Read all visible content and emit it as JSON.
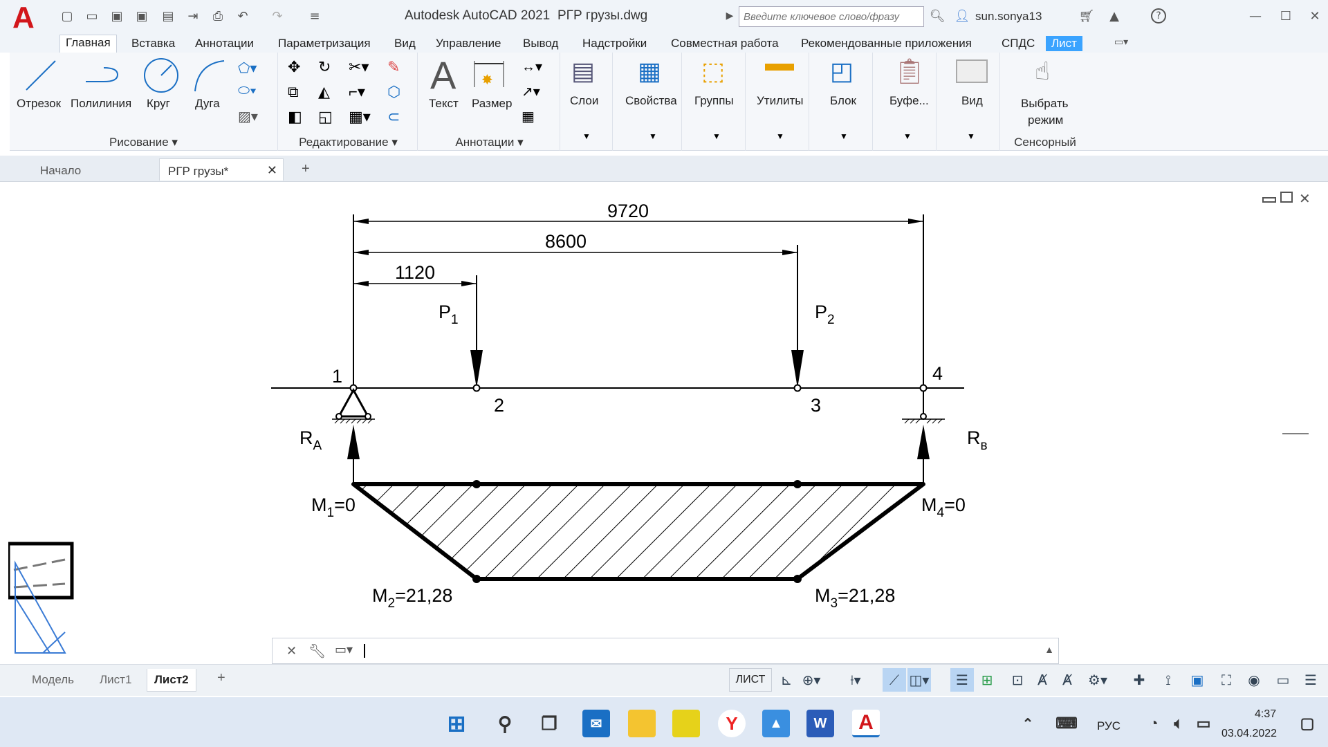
{
  "app": {
    "title": "Autodesk AutoCAD 2021",
    "file": "РГР грузы.dwg",
    "search_placeholder": "Введите ключевое слово/фразу",
    "user": "sun.sonya13"
  },
  "menu_tabs": [
    "Главная",
    "Вставка",
    "Аннотации",
    "Параметризация",
    "Вид",
    "Управление",
    "Вывод",
    "Надстройки",
    "Совместная работа",
    "Рекомендованные приложения",
    "СПДС",
    "Лист"
  ],
  "ribbon": {
    "draw": {
      "title": "Рисование",
      "tools": [
        "Отрезок",
        "Полилиния",
        "Круг",
        "Дуга"
      ]
    },
    "edit": {
      "title": "Редактирование"
    },
    "annot": {
      "title": "Аннотации",
      "tools": [
        "Текст",
        "Размер"
      ]
    },
    "big": [
      "Слои",
      "Свойства",
      "Группы",
      "Утилиты",
      "Блок",
      "Буфе...",
      "Вид"
    ],
    "touch": {
      "label1": "Выбрать",
      "label2": "режим",
      "title": "Сенсорный"
    }
  },
  "doc_tabs": [
    "Начало",
    "РГР грузы*"
  ],
  "layout_tabs": [
    "Модель",
    "Лист1",
    "Лист2"
  ],
  "status": {
    "mode": "ЛИСТ"
  },
  "taskbar": {
    "lang": "РУС",
    "time": "4:37",
    "date": "03.04.2022"
  },
  "drawing": {
    "dims": [
      "9720",
      "8600",
      "1120"
    ],
    "loads": [
      {
        "label": "P",
        "sub": "1"
      },
      {
        "label": "P",
        "sub": "2"
      }
    ],
    "nodes": [
      "1",
      "2",
      "3",
      "4"
    ],
    "reactions": [
      {
        "label": "R",
        "sub": "A"
      },
      {
        "label": "R",
        "sub": "в"
      }
    ],
    "moments": [
      {
        "prefix": "M",
        "sub": "1",
        "value": "=0"
      },
      {
        "prefix": "M",
        "sub": "4",
        "value": "=0"
      },
      {
        "prefix": "M",
        "sub": "2",
        "value": "=21,28"
      },
      {
        "prefix": "M",
        "sub": "3",
        "value": "=21,28"
      }
    ]
  }
}
